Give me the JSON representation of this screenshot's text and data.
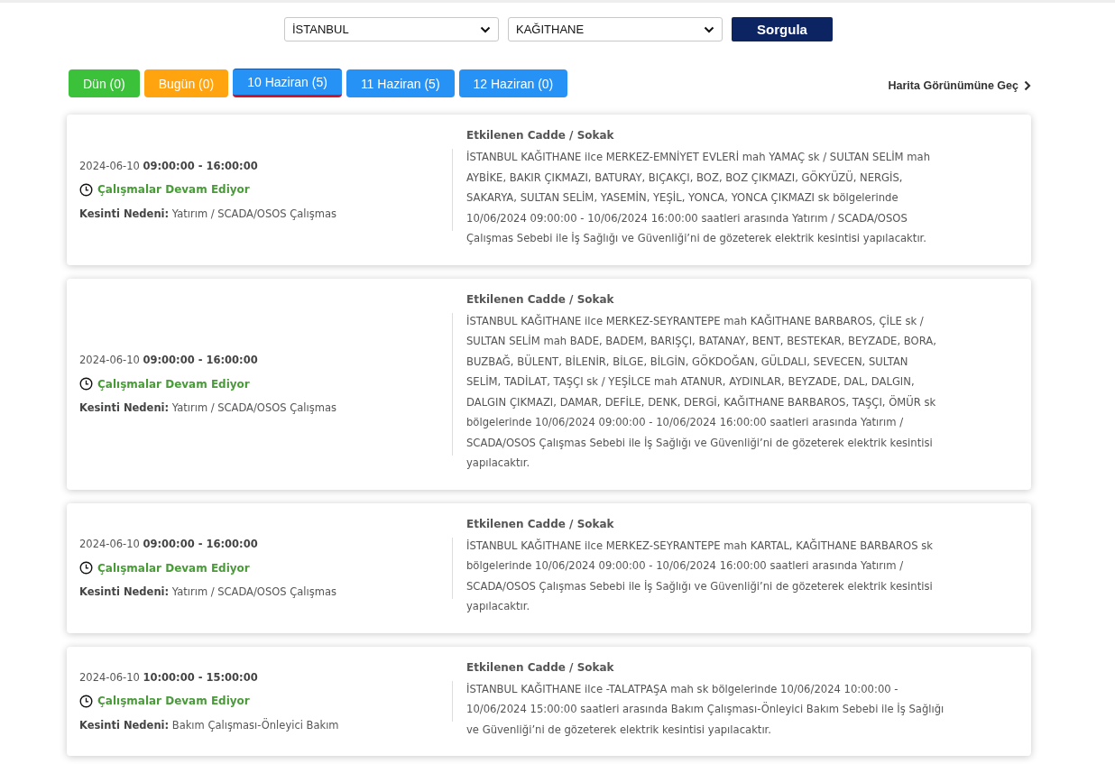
{
  "filters": {
    "city": "İSTANBUL",
    "district": "KAĞITHANE",
    "submit": "Sorgula"
  },
  "day_tabs": [
    {
      "label": "Dün (0)",
      "color": "#3cc13b",
      "selected": false
    },
    {
      "label": "Bugün (0)",
      "color": "#ffa30f",
      "selected": false
    },
    {
      "label": "10 Haziran (5)",
      "color": "#2692f5",
      "selected": true
    },
    {
      "label": "11 Haziran (5)",
      "color": "#2692f5",
      "selected": false
    },
    {
      "label": "12 Haziran (0)",
      "color": "#2692f5",
      "selected": false
    }
  ],
  "map_link": "Harita Görünümüne Geç",
  "outages": [
    {
      "time": "2024-06-10 **09:00:00 - 16:00:00**",
      "status": "Çalışmalar Devam Ediyor",
      "reason": "**Kesinti Nedeni:** Yatırım / SCADA/OSOS Çalışmas",
      "streets_title": "Etkilenen Cadde / Sokak",
      "streets": "İSTANBUL KAĞITHANE ilce MERKEZ-EMNİYET EVLERİ mah YAMAÇ sk / SULTAN SELİM mah AYBİKE, BAKIR ÇIKMAZI, BATURAY, BIÇAKÇI, BOZ, BOZ ÇIKMAZI, GÖKYÜZÜ, NERGİS, SAKARYA, SULTAN SELİM, YASEMİN, YEŞİL, YONCA, YONCA ÇIKMAZI sk bölgelerinde 10/06/2024 09:00:00 - 10/06/2024 16:00:00 saatleri arasında Yatırım / SCADA/OSOS Çalışmas Sebebi ile İş Sağlığı ve Güvenliği’ni de gözeterek elektrik kesintisi yapılacaktır."
    },
    {
      "time": "2024-06-10 **09:00:00 - 16:00:00**",
      "status": "Çalışmalar Devam Ediyor",
      "reason": "**Kesinti Nedeni:** Yatırım / SCADA/OSOS Çalışmas",
      "streets_title": "Etkilenen Cadde / Sokak",
      "streets": "İSTANBUL KAĞITHANE ilce MERKEZ-SEYRANTEPE mah KAĞITHANE BARBAROS, ÇİLE sk / SULTAN SELİM mah BADE, BADEM, BARIŞÇI, BATANAY, BENT, BESTEKAR, BEYZADE, BORA, BUZBAĞ, BÜLENT, BİLENİR, BİLGE, BİLGİN, GÖKDOĞAN, GÜLDALI, SEVECEN, SULTAN SELİM, TADİLAT, TAŞÇI sk / YEŞİLCE mah ATANUR, AYDINLAR, BEYZADE, DAL, DALGIN, DALGIN ÇIKMAZI, DAMAR, DEFİLE, DENK, DERGİ, KAĞITHANE BARBAROS, TAŞÇI, ÖMÜR sk bölgelerinde 10/06/2024 09:00:00 - 10/06/2024 16:00:00 saatleri arasında Yatırım / SCADA/OSOS Çalışmas Sebebi ile İş Sağlığı ve Güvenliği’ni de gözeterek elektrik kesintisi yapılacaktır."
    },
    {
      "time": "2024-06-10 **09:00:00 - 16:00:00**",
      "status": "Çalışmalar Devam Ediyor",
      "reason": "**Kesinti Nedeni:** Yatırım / SCADA/OSOS Çalışmas",
      "streets_title": "Etkilenen Cadde / Sokak",
      "streets": "İSTANBUL KAĞITHANE ilce MERKEZ-SEYRANTEPE mah KARTAL, KAĞITHANE BARBAROS sk bölgelerinde 10/06/2024 09:00:00 - 10/06/2024 16:00:00 saatleri arasında Yatırım / SCADA/OSOS Çalışmas Sebebi ile İş Sağlığı ve Güvenliği’ni de gözeterek elektrik kesintisi yapılacaktır."
    },
    {
      "time": "2024-06-10 **10:00:00 - 15:00:00**",
      "status": "Çalışmalar Devam Ediyor",
      "reason": "**Kesinti Nedeni:** Bakım Çalışması-Önleyici Bakım",
      "streets_title": "Etkilenen Cadde / Sokak",
      "streets": "İSTANBUL KAĞITHANE ilce -TALATPAŞA mah sk bölgelerinde 10/06/2024 10:00:00 - 10/06/2024 15:00:00 saatleri arasında Bakım Çalışması-Önleyici Bakım Sebebi ile İş Sağlığı ve Güvenliği’ni de gözeterek elektrik kesintisi yapılacaktır."
    }
  ]
}
